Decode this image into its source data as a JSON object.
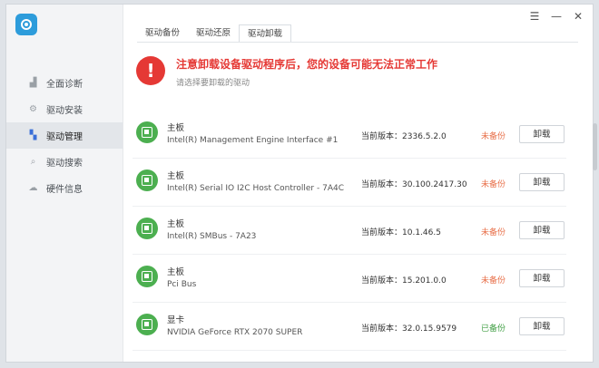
{
  "sidebar": {
    "logo_icon": "shield-gear-icon",
    "items": [
      {
        "label": "全面诊断",
        "icon": "chart-icon",
        "active": false
      },
      {
        "label": "驱动安装",
        "icon": "gear-icon",
        "active": false
      },
      {
        "label": "驱动管理",
        "icon": "grid-icon",
        "active": true
      },
      {
        "label": "驱动搜索",
        "icon": "search-icon",
        "active": false
      },
      {
        "label": "硬件信息",
        "icon": "cloud-icon",
        "active": false
      }
    ]
  },
  "tabs": [
    {
      "label": "驱动备份",
      "active": false
    },
    {
      "label": "驱动还原",
      "active": false
    },
    {
      "label": "驱动卸载",
      "active": true
    }
  ],
  "window_controls": [
    "menu-icon",
    "minimize-icon",
    "close-icon"
  ],
  "alert": {
    "title": "注意卸载设备驱动程序后，您的设备可能无法正常工作",
    "subtitle": "请选择要卸载的驱动",
    "icon": "exclamation-icon",
    "color": "#e53935"
  },
  "version_prefix": "当前版本：",
  "uninstall_label": "卸载",
  "drivers": [
    {
      "category": "主板",
      "name": "Intel(R) Management Engine Interface #1",
      "version": "2336.5.2.0",
      "status": "未备份",
      "status_color": "#e8704a"
    },
    {
      "category": "主板",
      "name": "Intel(R) Serial IO I2C Host Controller - 7A4C",
      "version": "30.100.2417.30",
      "status": "未备份",
      "status_color": "#e8704a"
    },
    {
      "category": "主板",
      "name": "Intel(R) SMBus - 7A23",
      "version": "10.1.46.5",
      "status": "未备份",
      "status_color": "#e8704a"
    },
    {
      "category": "主板",
      "name": "Pci Bus",
      "version": "15.201.0.0",
      "status": "未备份",
      "status_color": "#e8704a"
    },
    {
      "category": "显卡",
      "name": "NVIDIA GeForce RTX 2070 SUPER",
      "version": "32.0.15.9579",
      "status": "已备份",
      "status_color": "#43a047"
    }
  ]
}
